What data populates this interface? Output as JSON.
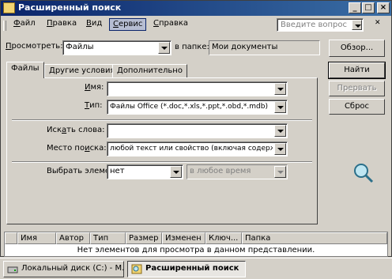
{
  "window": {
    "title": "Расширенный поиск",
    "minimize": "_",
    "maximize": "□",
    "close": "×"
  },
  "menu": {
    "items": [
      {
        "label": "Файл",
        "hotkey": "Ф",
        "rest": "айл"
      },
      {
        "label": "Правка",
        "hotkey": "П",
        "rest": "равка"
      },
      {
        "label": "Вид",
        "hotkey": "В",
        "rest": "ид"
      },
      {
        "label": "Сервис",
        "hotkey": "С",
        "rest": "ервис"
      },
      {
        "label": "Справка",
        "hotkey": "С",
        "rest": "правка"
      }
    ],
    "active_index": 3
  },
  "help_search": {
    "placeholder": "Введите вопрос"
  },
  "view_row": {
    "label_hot": "П",
    "label_rest": "росмотреть:",
    "value": "Файлы",
    "folder_label": "в папке:",
    "folder_value": "Мои документы",
    "browse_button": "Обзор..."
  },
  "buttons": {
    "find": "Найти",
    "stop": "Прервать",
    "reset": "Сброс",
    "stop_enabled": false
  },
  "tabs": [
    {
      "label": "Файлы",
      "active": true
    },
    {
      "label": "Другие условия",
      "active": false
    },
    {
      "label": "Дополнительно",
      "active": false
    }
  ],
  "form": {
    "name_label_hot": "И",
    "name_label_rest": "мя:",
    "name_value": "",
    "type_label_hot": "Т",
    "type_label_rest": "ип:",
    "type_value": "Файлы Office (*.doc,*.xls,*.ppt,*.obd,*.mdb)",
    "search_words_label_pre": "Иск",
    "search_words_label_hot": "а",
    "search_words_label_post": "ть слова:",
    "search_words_value": "",
    "search_place_label_pre": "Место по",
    "search_place_label_hot": "и",
    "search_place_label_post": "ска:",
    "search_place_value": "любой текст или свойство (включая содерж",
    "select_label_pre": "Выбрать элемен",
    "select_label_hot": "т",
    "select_label_post": "ы:",
    "select_value": "нет",
    "time_value": "в любое время"
  },
  "results": {
    "columns": [
      "Имя",
      "Автор",
      "Тип",
      "Размер",
      "Изменен",
      "Ключ...",
      "Папка"
    ],
    "empty_message": "Нет элементов для просмотра в данном представлении."
  },
  "taskbar": [
    {
      "label": "Локальный диск (C:) - М...",
      "pressed": false
    },
    {
      "label": "Расширенный поиск",
      "pressed": true
    }
  ]
}
